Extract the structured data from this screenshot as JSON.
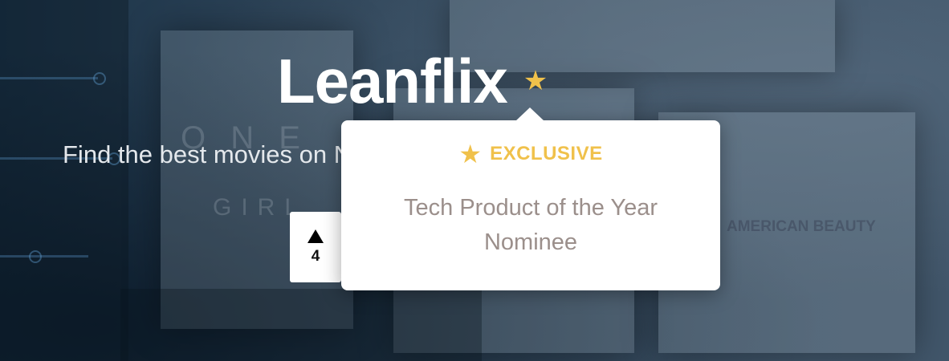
{
  "hero": {
    "title": "Leanflix",
    "subtitle": "Find the best movies on Netflix, Hulu, Amazon and more"
  },
  "upvote": {
    "count": "4"
  },
  "tooltip": {
    "badge_label": "EXCLUSIVE",
    "description": "Tech Product of the Year Nominee"
  },
  "background": {
    "poster_words": [
      "O N E",
      "GIRL",
      "AMERICAN BEAUTY"
    ]
  },
  "colors": {
    "accent_gold": "#f0c14b",
    "title_white": "#ffffff",
    "description_gray": "#9b8f8b",
    "background_navy": "#34475c"
  },
  "icons": {
    "title_badge": "star-icon",
    "tooltip_badge": "star-icon",
    "upvote": "up-arrow-icon"
  }
}
